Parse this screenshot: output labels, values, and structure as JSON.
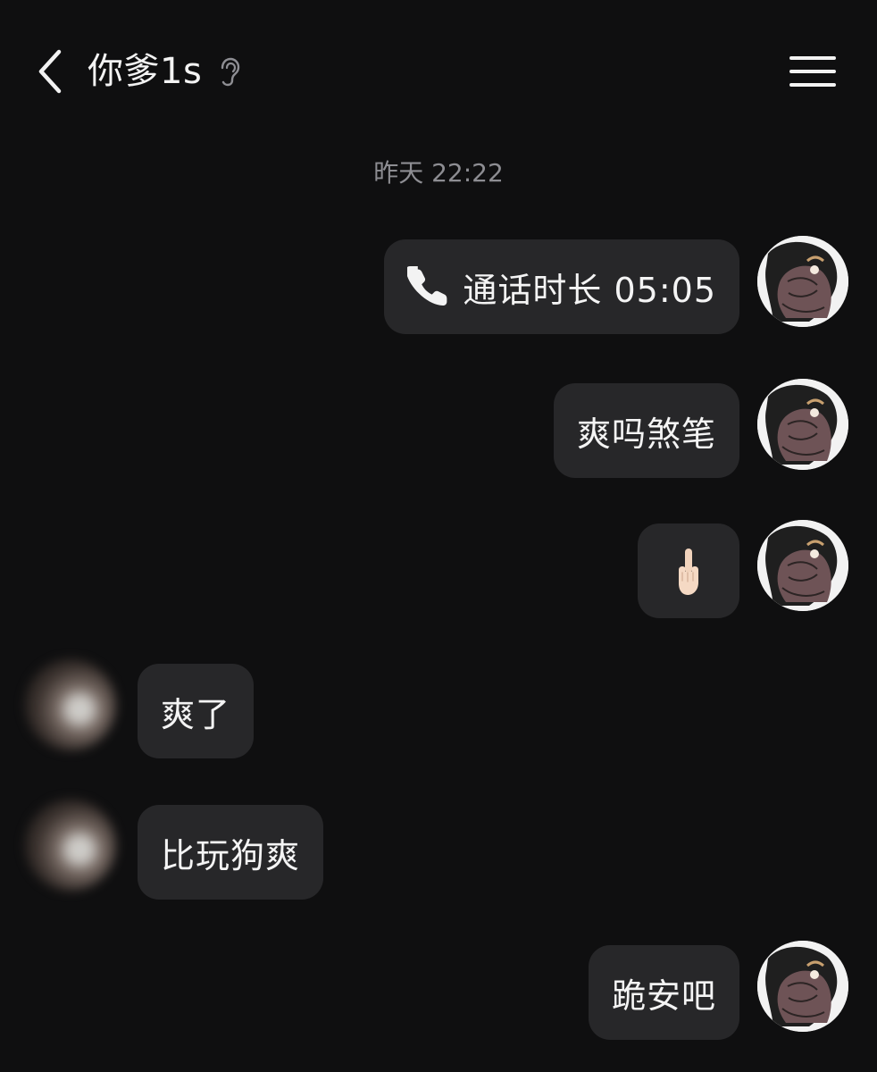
{
  "header": {
    "back_icon": "chevron-left-icon",
    "title": "你爹1s",
    "ear_icon": "ear-icon",
    "menu_icon": "hamburger-menu-icon"
  },
  "timestamp": "昨天 22:22",
  "messages": [
    {
      "side": "right",
      "type": "call",
      "icon": "phone-icon",
      "text": "通话时长 05:05"
    },
    {
      "side": "right",
      "type": "text",
      "text": "爽吗煞笔"
    },
    {
      "side": "right",
      "type": "emoji",
      "icon": "middle-finger-icon",
      "text": ""
    },
    {
      "side": "left",
      "type": "text",
      "text": "爽了"
    },
    {
      "side": "left",
      "type": "text",
      "text": "比玩狗爽"
    },
    {
      "side": "right",
      "type": "text",
      "text": "跪安吧"
    }
  ],
  "colors": {
    "background": "#0f0f10",
    "bubble": "#272729",
    "text": "#f4f4f4",
    "muted": "#8d8d92"
  }
}
